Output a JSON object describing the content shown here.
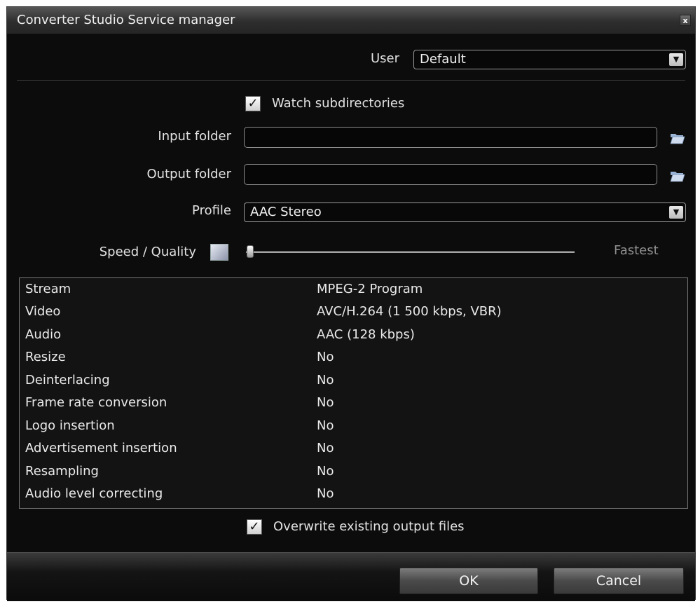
{
  "window": {
    "title": "Converter Studio Service manager",
    "close_label": "x"
  },
  "user": {
    "label": "User",
    "value": "Default"
  },
  "watch_subdirectories": {
    "label": "Watch subdirectories",
    "checked": true
  },
  "input_folder": {
    "label": "Input folder",
    "value": ""
  },
  "output_folder": {
    "label": "Output folder",
    "value": ""
  },
  "profile": {
    "label": "Profile",
    "value": "AAC Stereo"
  },
  "speed_quality": {
    "label": "Speed / Quality",
    "value_text": "Fastest",
    "level": 0
  },
  "settings_table": {
    "rows": [
      {
        "name": "Stream",
        "value": "MPEG-2 Program"
      },
      {
        "name": "Video",
        "value": "AVC/H.264 (1 500 kbps, VBR)"
      },
      {
        "name": "Audio",
        "value": "AAC (128 kbps)"
      },
      {
        "name": "Resize",
        "value": "No"
      },
      {
        "name": "Deinterlacing",
        "value": "No"
      },
      {
        "name": "Frame rate conversion",
        "value": "No"
      },
      {
        "name": "Logo insertion",
        "value": "No"
      },
      {
        "name": "Advertisement insertion",
        "value": "No"
      },
      {
        "name": "Resampling",
        "value": "No"
      },
      {
        "name": "Audio level correcting",
        "value": "No"
      }
    ]
  },
  "overwrite_existing": {
    "label": "Overwrite existing output files",
    "checked": true
  },
  "buttons": {
    "ok": "OK",
    "cancel": "Cancel"
  },
  "icons": {
    "folder": "folder-open-icon",
    "check": "checkmark-icon",
    "dropdown": "chevron-down-icon"
  },
  "colors": {
    "background": "#0c0c0c",
    "text": "#e2e2e2",
    "border": "#9a9a9a"
  }
}
